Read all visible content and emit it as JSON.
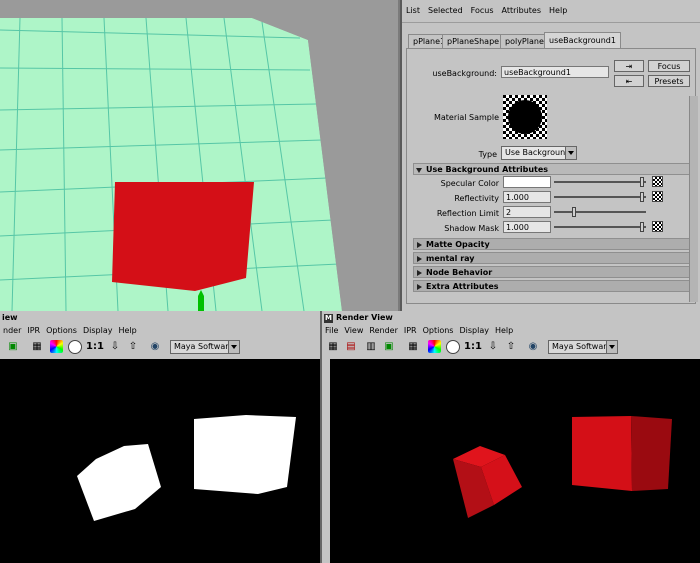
{
  "attribute_editor": {
    "menu": [
      "List",
      "Selected",
      "Focus",
      "Attributes",
      "Help"
    ],
    "tabs": [
      "pPlane1",
      "pPlaneShape1",
      "polyPlane1",
      "useBackground1"
    ],
    "node_label": "useBackground:",
    "node_value": "useBackground1",
    "focus_label": "Focus",
    "presets_label": "Presets",
    "material_sample_label": "Material Sample",
    "type_label": "Type",
    "type_value": "Use Background",
    "section_open": "Use Background Attributes",
    "attributes": [
      {
        "label": "Specular Color",
        "value": "",
        "slider": 0.98
      },
      {
        "label": "Reflectivity",
        "value": "1.000",
        "slider": 0.98
      },
      {
        "label": "Reflection Limit",
        "value": "2",
        "slider": 0.2
      },
      {
        "label": "Shadow Mask",
        "value": "1.000",
        "slider": 0.98
      }
    ],
    "sections_closed": [
      "Matte Opacity",
      "mental ray",
      "Node Behavior",
      "Extra Attributes"
    ]
  },
  "render_view_left": {
    "title": "iew",
    "menu": [
      "nder",
      "IPR",
      "Options",
      "Display",
      "Help"
    ],
    "renderer": "Maya Software",
    "ratio": "1:1"
  },
  "render_view_right": {
    "title": "Render View",
    "menu": [
      "File",
      "View",
      "Render",
      "IPR",
      "Options",
      "Display",
      "Help"
    ],
    "renderer": "Maya Software",
    "ratio": "1:1"
  },
  "colors": {
    "plane_green": "#aef5c8",
    "grid_line": "#56c6a6",
    "cube_red": "#d40f17",
    "panel_gray": "#c4c4c4"
  }
}
